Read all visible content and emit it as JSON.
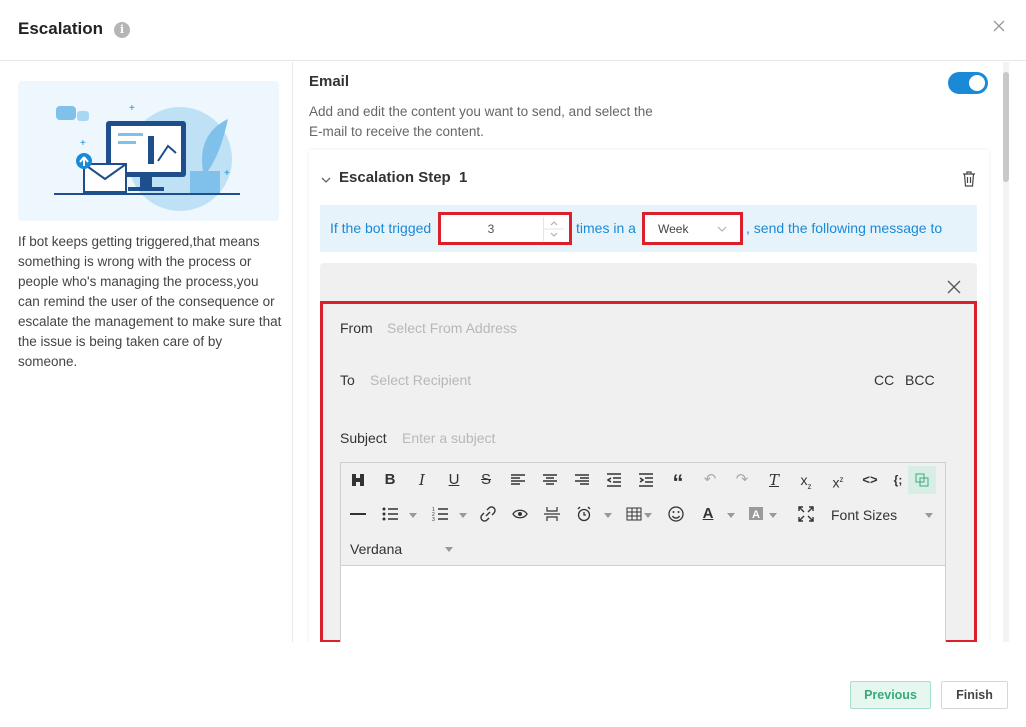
{
  "header": {
    "title": "Escalation",
    "info_icon": "info-icon",
    "close_icon": "close-icon"
  },
  "left": {
    "description": "If bot keeps getting triggered,that means something is wrong with the process or people who's managing the process,you can remind the user of the consequence or escalate the management to make sure that the issue is being taken care of by someone."
  },
  "email_section": {
    "title": "Email",
    "enabled": true,
    "description": "Add and edit the content you want to send, and select the E-mail to receive the content."
  },
  "step": {
    "title": "Escalation Step",
    "number": "1",
    "trigger": {
      "prefix": "If the bot trigged",
      "count": "3",
      "middle": "times in a",
      "period": "Week",
      "suffix": ", send the following message to"
    }
  },
  "email_form": {
    "from_label": "From",
    "from_placeholder": "Select From Address",
    "to_label": "To",
    "to_placeholder": "Select Recipient",
    "cc": "CC",
    "bcc": "BCC",
    "subject_label": "Subject",
    "subject_placeholder": "Enter a subject"
  },
  "editor": {
    "font_sizes_label": "Font Sizes",
    "font_family": "Verdana"
  },
  "footer": {
    "previous": "Previous",
    "finish": "Finish"
  },
  "colors": {
    "accent": "#1a8ad6",
    "highlight": "#d9202b",
    "previous_text": "#3aa97a"
  }
}
